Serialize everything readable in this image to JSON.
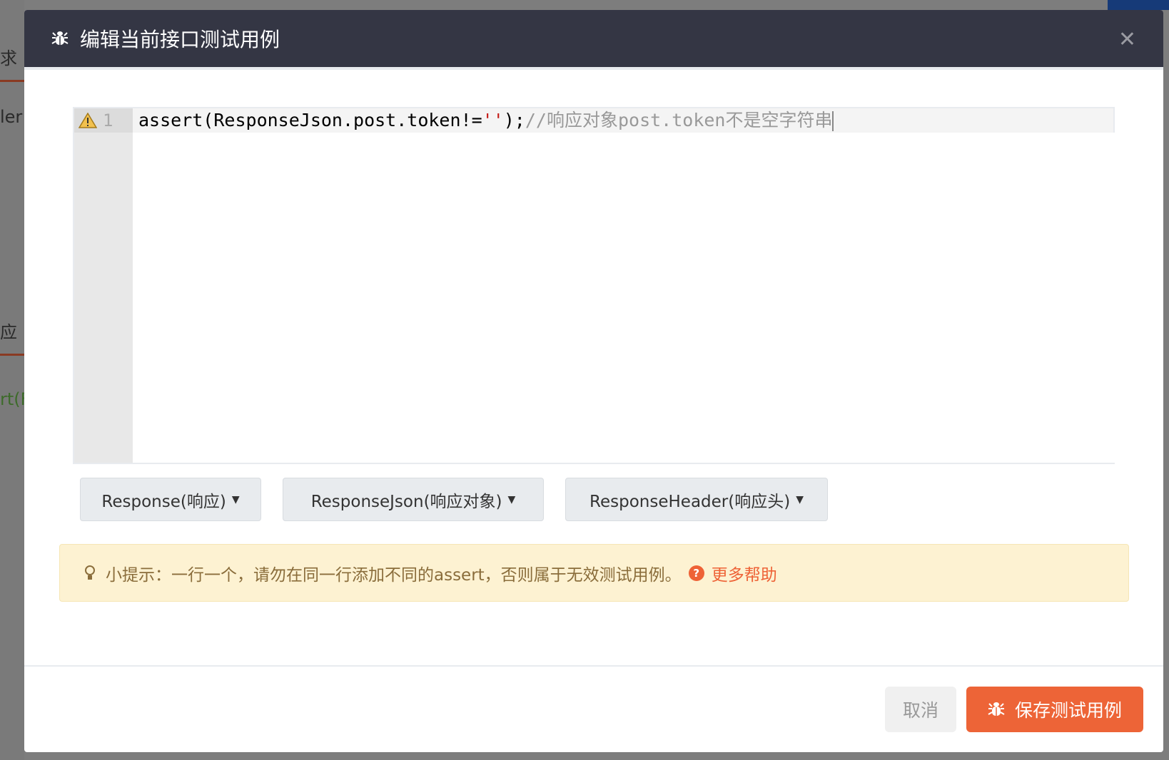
{
  "background": {
    "fragments": [
      "求",
      "ler",
      "应",
      "rt(F"
    ]
  },
  "modal": {
    "title": "编辑当前接口测试用例",
    "title_icon": "bug-icon",
    "close_icon": "close-icon",
    "editor": {
      "line_number": "1",
      "warning_icon": "warning-icon",
      "code": "assert(ResponseJson.post.token!=",
      "string": "''",
      "code_end": ");",
      "comment": "//响应对象post.token不是空字符串"
    },
    "dropdowns": [
      {
        "label": "Response(响应)"
      },
      {
        "label": "ResponseJson(响应对象)"
      },
      {
        "label": "ResponseHeader(响应头)"
      }
    ],
    "tip": {
      "icon": "lightbulb-icon",
      "text": "小提示：一行一个，请勿在同一行添加不同的assert，否则属于无效测试用例。",
      "help_label": "更多帮助"
    },
    "cancel_label": "取消",
    "save_label": "保存测试用例",
    "colors": {
      "header": "#343644",
      "primary": "#ed6437",
      "tip_bg": "#fdf2d2"
    }
  }
}
